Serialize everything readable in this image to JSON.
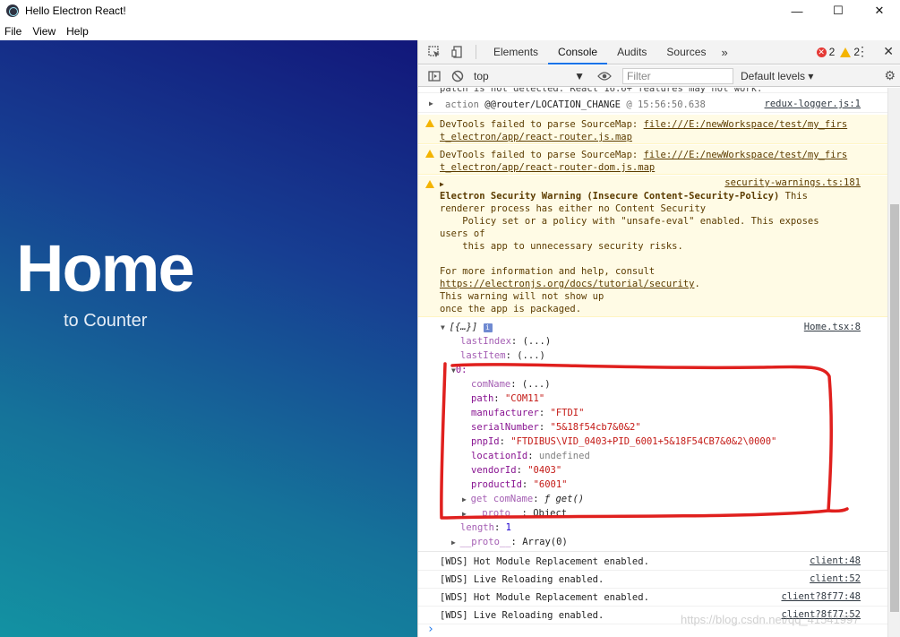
{
  "window": {
    "title": "Hello Electron React!",
    "controls": {
      "minimize": "—",
      "maximize": "☐",
      "close": "✕"
    }
  },
  "menu": [
    "File",
    "View",
    "Help"
  ],
  "app": {
    "heading": "Home",
    "link": "to Counter"
  },
  "devtools": {
    "tabs": [
      "Elements",
      "Console",
      "Audits",
      "Sources"
    ],
    "active_tab": "Console",
    "more": "»",
    "error_count": "2",
    "warning_count": "2",
    "context": "top",
    "filter_placeholder": "Filter",
    "levels": "Default levels ▾",
    "colors": {
      "warn_bg": "#fffbe5",
      "annotation": "#e0201e",
      "accent": "#1a73e8"
    }
  },
  "console": {
    "cut_line": "patch is not detected. React 16.6+ features may not work.",
    "action": {
      "prefix": "action",
      "type": "@@router/LOCATION_CHANGE",
      "at": "@ 15:56:50.638",
      "source": "redux-logger.js:1"
    },
    "warn1": {
      "prefix": "DevTools failed to parse SourceMap: ",
      "url_a": "file:///E:/newWorkspace/test/my_firs",
      "url_b": "t_electron/app/react-router.js.map"
    },
    "warn2": {
      "prefix": "DevTools failed to parse SourceMap: ",
      "url_a": "file:///E:/newWorkspace/test/my_firs",
      "url_b": "t_electron/app/react-router-dom.js.map"
    },
    "security": {
      "source": "security-warnings.ts:181",
      "title": "Electron Security Warning (Insecure Content-Security-Policy)",
      "title_tail": " This",
      "lines": [
        "renderer process has either no Content Security",
        "    Policy set or a policy with \"unsafe-eval\" enabled. This exposes",
        "users of",
        "    this app to unnecessary security risks.",
        "",
        "For more information and help, consult"
      ],
      "link": "https://electronjs.org/docs/tutorial/security",
      "link_tail": ".",
      "after": [
        "This warning will not show up",
        "once the app is packaged."
      ]
    },
    "object": {
      "summary": "[{…}]",
      "info": "i",
      "source": "Home.tsx:8",
      "lastIndex": {
        "key": "lastIndex",
        "val": "(...)"
      },
      "lastItem": {
        "key": "lastItem",
        "val": "(...)"
      },
      "index0": "0:",
      "props": [
        {
          "key": "comName",
          "val": "(...)",
          "kind": "plain"
        },
        {
          "key": "path",
          "val": "\"COM11\"",
          "kind": "string"
        },
        {
          "key": "manufacturer",
          "val": "\"FTDI\"",
          "kind": "string"
        },
        {
          "key": "serialNumber",
          "val": "\"5&18f54cb7&0&2\"",
          "kind": "string"
        },
        {
          "key": "pnpId",
          "val": "\"FTDIBUS\\VID_0403+PID_6001+5&18F54CB7&0&2\\0000\"",
          "kind": "string"
        },
        {
          "key": "locationId",
          "val": "undefined",
          "kind": "undef"
        },
        {
          "key": "vendorId",
          "val": "\"0403\"",
          "kind": "string"
        },
        {
          "key": "productId",
          "val": "\"6001\"",
          "kind": "string"
        }
      ],
      "getter": {
        "key": "get comName",
        "val": "ƒ get()"
      },
      "proto_obj": {
        "key": "__proto__",
        "val": "Object"
      },
      "length": {
        "key": "length",
        "val": "1"
      },
      "proto_arr": {
        "key": "__proto__",
        "val": "Array(0)"
      }
    },
    "wds": [
      {
        "text": "[WDS] Hot Module Replacement enabled.",
        "source": "client:48"
      },
      {
        "text": "[WDS] Live Reloading enabled.",
        "source": "client:52"
      },
      {
        "text": "[WDS] Hot Module Replacement enabled.",
        "source": "client?8f77:48"
      },
      {
        "text": "[WDS] Live Reloading enabled.",
        "source": "client?8f77:52"
      }
    ],
    "prompt": "›"
  },
  "watermark": "https://blog.csdn.net/qq_41541997"
}
